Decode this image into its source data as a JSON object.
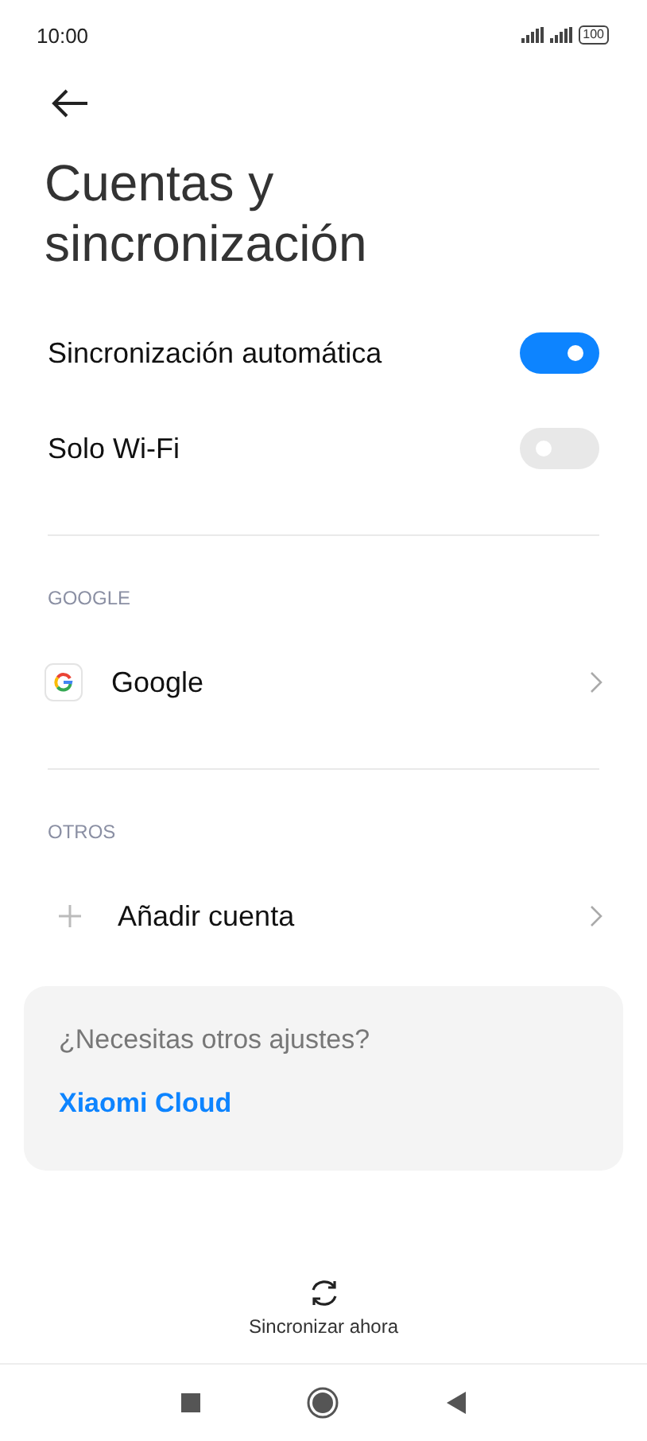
{
  "status_bar": {
    "time": "10:00",
    "battery": "100"
  },
  "title": "Cuentas y sincronización",
  "toggles": [
    {
      "label": "Sincronización automática",
      "on": true
    },
    {
      "label": "Solo Wi-Fi",
      "on": false
    }
  ],
  "sections": [
    {
      "header": "GOOGLE",
      "items": [
        {
          "kind": "google",
          "label": "Google"
        }
      ]
    },
    {
      "header": "OTROS",
      "items": [
        {
          "kind": "add",
          "label": "Añadir cuenta"
        }
      ]
    }
  ],
  "card": {
    "question": "¿Necesitas otros ajustes?",
    "link": "Xiaomi Cloud"
  },
  "sync_button": "Sincronizar ahora"
}
